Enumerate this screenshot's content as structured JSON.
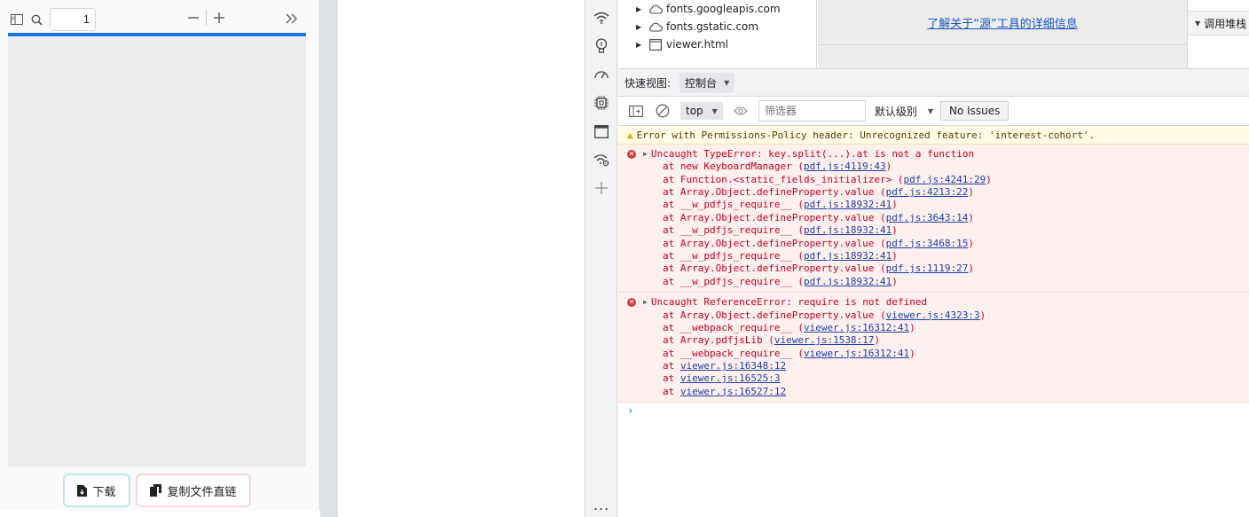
{
  "viewer": {
    "page_number": "1",
    "load_progress": 1.0,
    "download_label": "下载",
    "copy_link_label": "复制文件直链"
  },
  "sources": {
    "tree": [
      {
        "label": "fonts.googleapis.com",
        "icon": "cloud-icon"
      },
      {
        "label": "fonts.gstatic.com",
        "icon": "cloud-icon"
      },
      {
        "label": "viewer.html",
        "icon": "file-icon"
      }
    ],
    "info_link": "了解关于“源”工具的详细信息",
    "callstack_label": "调用堆栈"
  },
  "quick_view": {
    "label": "快速视图:",
    "selected": "控制台"
  },
  "console_toolbar": {
    "context": "top",
    "filter_placeholder": "筛选器",
    "level": "默认级别",
    "issues": "No Issues"
  },
  "console": {
    "warning": "Error with Permissions-Policy header: Unrecognized feature: 'interest-cohort'.",
    "errors": [
      {
        "message": "Uncaught TypeError: key.split(...).at is not a function",
        "stack": [
          {
            "prefix": "at new KeyboardManager (",
            "link": "pdf.js:4119:43",
            "suffix": ")"
          },
          {
            "prefix": "at Function.<static_fields_initializer> (",
            "link": "pdf.js:4241:29",
            "suffix": ")"
          },
          {
            "prefix": "at Array.Object.defineProperty.value (",
            "link": "pdf.js:4213:22",
            "suffix": ")"
          },
          {
            "prefix": "at __w_pdfjs_require__ (",
            "link": "pdf.js:18932:41",
            "suffix": ")"
          },
          {
            "prefix": "at Array.Object.defineProperty.value (",
            "link": "pdf.js:3643:14",
            "suffix": ")"
          },
          {
            "prefix": "at __w_pdfjs_require__ (",
            "link": "pdf.js:18932:41",
            "suffix": ")"
          },
          {
            "prefix": "at Array.Object.defineProperty.value (",
            "link": "pdf.js:3468:15",
            "suffix": ")"
          },
          {
            "prefix": "at __w_pdfjs_require__ (",
            "link": "pdf.js:18932:41",
            "suffix": ")"
          },
          {
            "prefix": "at Array.Object.defineProperty.value (",
            "link": "pdf.js:1119:27",
            "suffix": ")"
          },
          {
            "prefix": "at __w_pdfjs_require__ (",
            "link": "pdf.js:18932:41",
            "suffix": ")"
          }
        ]
      },
      {
        "message": "Uncaught ReferenceError: require is not defined",
        "stack": [
          {
            "prefix": "at Array.Object.defineProperty.value (",
            "link": "viewer.js:4323:3",
            "suffix": ")"
          },
          {
            "prefix": "at __webpack_require__ (",
            "link": "viewer.js:16312:41",
            "suffix": ")"
          },
          {
            "prefix": "at Array.pdfjsLib (",
            "link": "viewer.js:1538:17",
            "suffix": ")"
          },
          {
            "prefix": "at __webpack_require__ (",
            "link": "viewer.js:16312:41",
            "suffix": ")"
          },
          {
            "prefix": "at ",
            "link": "viewer.js:16348:12",
            "suffix": ""
          },
          {
            "prefix": "at ",
            "link": "viewer.js:16525:3",
            "suffix": ""
          },
          {
            "prefix": "at ",
            "link": "viewer.js:16527:12",
            "suffix": ""
          }
        ]
      }
    ],
    "prompt": "›"
  },
  "devtools_sidebar": {
    "more": "..."
  }
}
